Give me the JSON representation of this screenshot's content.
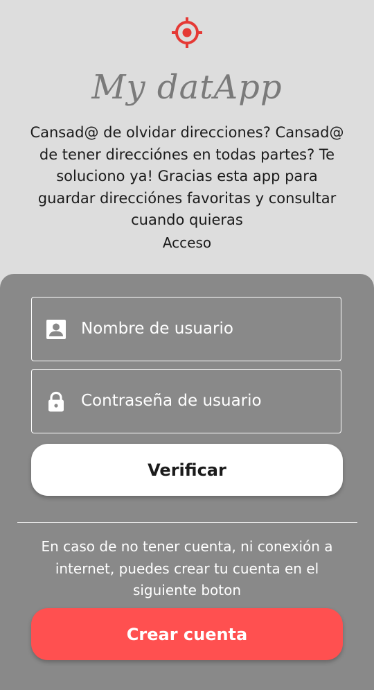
{
  "header": {
    "logo_icon": "target-crosshair-icon",
    "title": "My datApp",
    "description": "Cansad@ de olvidar direcciones? Cansad@ de tener direcciónes en todas partes? Te soluciono ya! Gracias esta app para guardar direcciónes favoritas y consultar cuando quieras",
    "access_label": "Acceso"
  },
  "login": {
    "username_placeholder": "Nombre de usuario",
    "username_icon": "account-box-icon",
    "password_placeholder": "Contraseña de usuario",
    "password_icon": "lock-icon",
    "verify_label": "Verificar"
  },
  "signup": {
    "info_text": "En caso de no tener cuenta, ni conexión a internet, puedes crear tu cuenta en el siguiente boton",
    "create_label": "Crear cuenta"
  },
  "colors": {
    "background": "#dddddd",
    "panel": "#898989",
    "accent": "#ff5050",
    "logo": "#e53935"
  }
}
